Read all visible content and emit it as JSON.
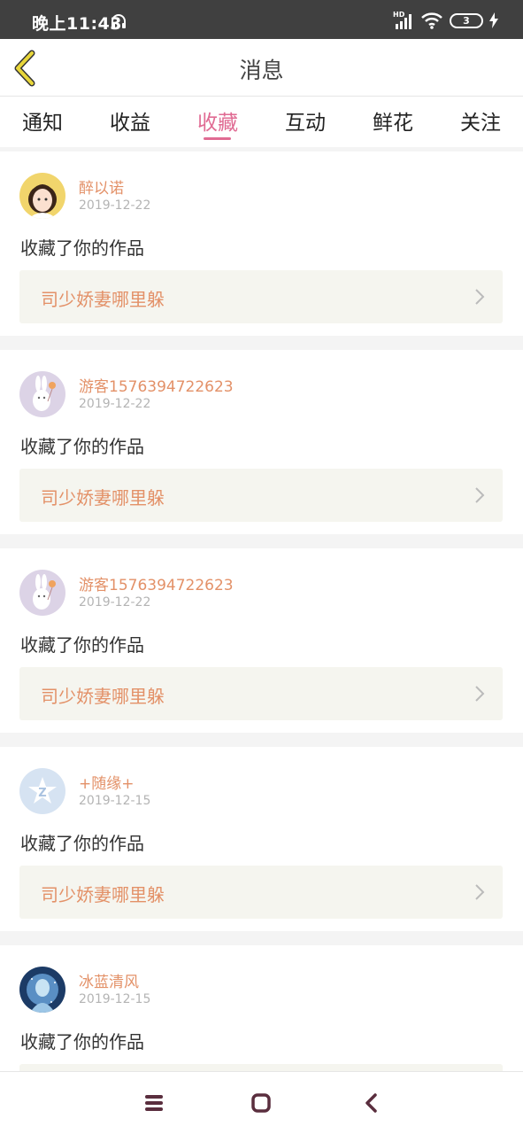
{
  "status_bar": {
    "time": "晚上11:43",
    "network_label": "HD",
    "battery_level": "3",
    "icons": [
      "headset-icon",
      "signal-icon",
      "wifi-icon",
      "battery-icon",
      "charging-icon"
    ]
  },
  "header": {
    "title": "消息",
    "back_icon": "back-chevron-icon",
    "back_icon_color": "#e8d63a"
  },
  "tabs": [
    {
      "label": "通知",
      "active": false
    },
    {
      "label": "收益",
      "active": false
    },
    {
      "label": "收藏",
      "active": true
    },
    {
      "label": "互动",
      "active": false
    },
    {
      "label": "鲜花",
      "active": false
    },
    {
      "label": "关注",
      "active": false
    }
  ],
  "accent_color": "#e06b93",
  "name_color": "#e39168",
  "messages": [
    {
      "user": "醉以诺",
      "date": "2019-12-22",
      "action": "收藏了你的作品",
      "work": "司少娇妻哪里躲",
      "avatar": "girl-avatar"
    },
    {
      "user": "游客1576394722623",
      "date": "2019-12-22",
      "action": "收藏了你的作品",
      "work": "司少娇妻哪里躲",
      "avatar": "bunny-avatar"
    },
    {
      "user": "游客1576394722623",
      "date": "2019-12-22",
      "action": "收藏了你的作品",
      "work": "司少娇妻哪里躲",
      "avatar": "bunny-avatar"
    },
    {
      "user": "+随缘+",
      "date": "2019-12-15",
      "action": "收藏了你的作品",
      "work": "司少娇妻哪里躲",
      "avatar": "default-z-avatar"
    },
    {
      "user": "冰蓝清风",
      "date": "2019-12-15",
      "action": "收藏了你的作品",
      "work": "",
      "avatar": "ice-avatar"
    }
  ],
  "nav_bar": {
    "buttons": [
      "menu-icon",
      "home-icon",
      "back-icon"
    ]
  }
}
